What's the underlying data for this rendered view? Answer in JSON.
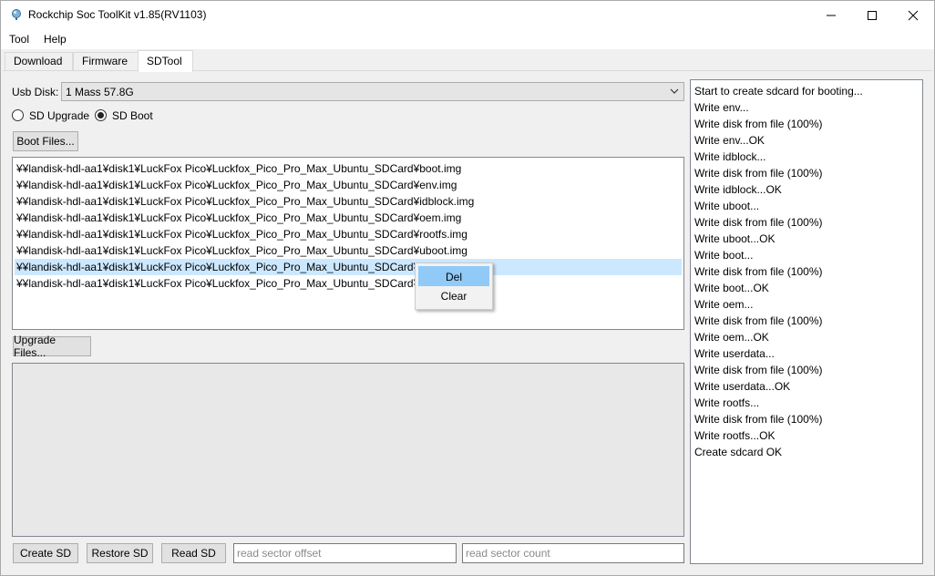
{
  "window": {
    "title": "Rockchip Soc ToolKit v1.85(RV1103)",
    "minimize_glyph": "—",
    "maximize_glyph": "☐",
    "close_glyph": "✕"
  },
  "menu": [
    "Tool",
    "Help"
  ],
  "tabs": [
    {
      "label": "Download",
      "active": false
    },
    {
      "label": "Firmware",
      "active": false
    },
    {
      "label": "SDTool",
      "active": true
    }
  ],
  "usb_disk": {
    "label": "Usb Disk:",
    "value": "1 Mass 57.8G"
  },
  "mode": {
    "sd_upgrade_label": "SD Upgrade",
    "sd_upgrade_checked": false,
    "sd_boot_label": "SD Boot",
    "sd_boot_checked": true
  },
  "boot_files_button": "Boot Files...",
  "boot_files": [
    "¥¥landisk-hdl-aa1¥disk1¥LuckFox Pico¥Luckfox_Pico_Pro_Max_Ubuntu_SDCard¥boot.img",
    "¥¥landisk-hdl-aa1¥disk1¥LuckFox Pico¥Luckfox_Pico_Pro_Max_Ubuntu_SDCard¥env.img",
    "¥¥landisk-hdl-aa1¥disk1¥LuckFox Pico¥Luckfox_Pico_Pro_Max_Ubuntu_SDCard¥idblock.img",
    "¥¥landisk-hdl-aa1¥disk1¥LuckFox Pico¥Luckfox_Pico_Pro_Max_Ubuntu_SDCard¥oem.img",
    "¥¥landisk-hdl-aa1¥disk1¥LuckFox Pico¥Luckfox_Pico_Pro_Max_Ubuntu_SDCard¥rootfs.img",
    "¥¥landisk-hdl-aa1¥disk1¥LuckFox Pico¥Luckfox_Pico_Pro_Max_Ubuntu_SDCard¥uboot.img",
    "¥¥landisk-hdl-aa1¥disk1¥LuckFox Pico¥Luckfox_Pico_Pro_Max_Ubuntu_SDCard¥update.img",
    "¥¥landisk-hdl-aa1¥disk1¥LuckFox Pico¥Luckfox_Pico_Pro_Max_Ubuntu_SDCard¥userdata.img"
  ],
  "selected_boot_file_index": 6,
  "upgrade_files_button": "Upgrade Files...",
  "context_menu": {
    "del": "Del",
    "clear": "Clear"
  },
  "bottom": {
    "create_sd": "Create SD",
    "restore_sd": "Restore SD",
    "read_sd": "Read SD",
    "sector_offset_placeholder": "read sector offset",
    "sector_count_placeholder": "read sector count"
  },
  "log": [
    "Start to create sdcard for booting...",
    "Write env...",
    "Write disk from file (100%)",
    "Write env...OK",
    "Write idblock...",
    "Write disk from file (100%)",
    "Write idblock...OK",
    "Write uboot...",
    "Write disk from file (100%)",
    "Write uboot...OK",
    "Write boot...",
    "Write disk from file (100%)",
    "Write boot...OK",
    "Write oem...",
    "Write disk from file (100%)",
    "Write oem...OK",
    "Write userdata...",
    "Write disk from file (100%)",
    "Write userdata...OK",
    "Write rootfs...",
    "Write disk from file (100%)",
    "Write rootfs...OK",
    "Create sdcard OK"
  ]
}
